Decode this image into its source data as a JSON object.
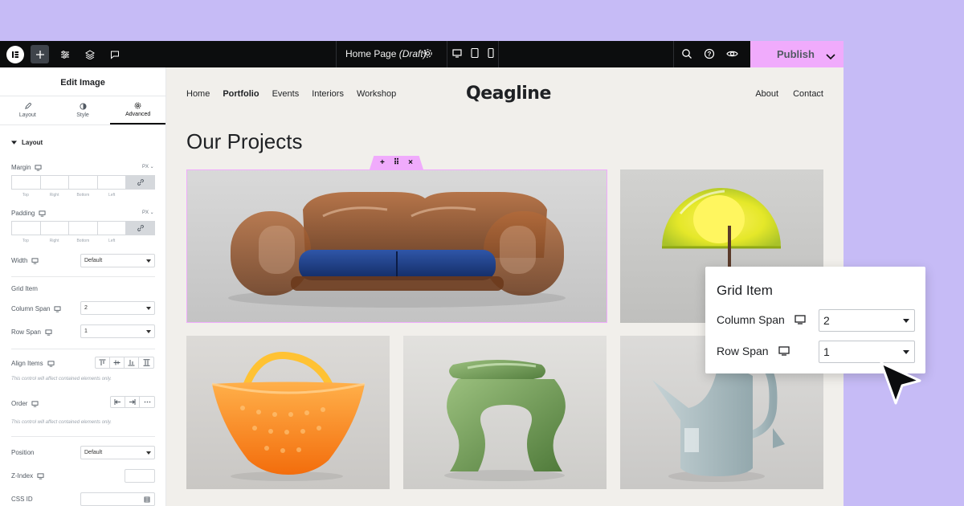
{
  "colors": {
    "accent": "#f0abfc",
    "topbar": "#0c0d0e",
    "backdrop": "#c6bbf6",
    "canvas": "#f1efeb"
  },
  "topbar": {
    "page_title": "Home Page",
    "page_status": "(Draft)",
    "publish_label": "Publish",
    "icons": [
      "elementor-logo-icon",
      "plus-icon",
      "sliders-icon",
      "layers-icon",
      "comment-icon",
      "gear-icon",
      "desktop-icon",
      "tablet-icon",
      "mobile-icon",
      "search-icon",
      "help-icon",
      "eye-icon",
      "chevron-down-icon"
    ]
  },
  "panel": {
    "title": "Edit Image",
    "tabs": [
      {
        "label": "Layout",
        "icon": "pencil-icon"
      },
      {
        "label": "Style",
        "icon": "contrast-icon"
      },
      {
        "label": "Advanced",
        "icon": "gear-icon"
      }
    ],
    "section": "Layout",
    "margin": {
      "label": "Margin",
      "unit": "PX",
      "sides": [
        "Top",
        "Right",
        "Bottom",
        "Left"
      ]
    },
    "padding": {
      "label": "Padding",
      "unit": "PX",
      "sides": [
        "Top",
        "Right",
        "Bottom",
        "Left"
      ]
    },
    "width": {
      "label": "Width",
      "value": "Default"
    },
    "grid_item": {
      "label": "Grid Item",
      "column_span_label": "Column Span",
      "column_span": "2",
      "row_span_label": "Row Span",
      "row_span": "1"
    },
    "align_items": {
      "label": "Align Items",
      "hint": "This control will affect contained elements only."
    },
    "order": {
      "label": "Order",
      "hint": "This control will affect contained elements only."
    },
    "position": {
      "label": "Position",
      "value": "Default"
    },
    "z_index": {
      "label": "Z-Index"
    },
    "css_id": {
      "label": "CSS ID"
    }
  },
  "site": {
    "nav_left": [
      "Home",
      "Portfolio",
      "Events",
      "Interiors",
      "Workshop"
    ],
    "brand": "Qeagline",
    "nav_right": [
      "About",
      "Contact"
    ],
    "heading": "Our Projects"
  },
  "popover": {
    "title": "Grid Item",
    "column_span_label": "Column Span",
    "column_span": "2",
    "row_span_label": "Row Span",
    "row_span": "1"
  }
}
